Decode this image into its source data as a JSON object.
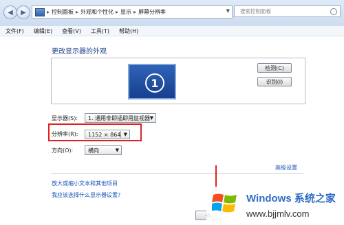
{
  "address_bar": {
    "breadcrumbs": [
      "控制面板",
      "外观和个性化",
      "显示",
      "屏幕分辨率"
    ],
    "search_placeholder": "搜索控制面板"
  },
  "menu": [
    "文件(F)",
    "编辑(E)",
    "查看(V)",
    "工具(T)",
    "帮助(H)"
  ],
  "main": {
    "title": "更改显示器的外观",
    "monitor_number": "1",
    "detect_label": "检测(C)",
    "identify_label": "识别(I)",
    "display_label": "显示器(S):",
    "display_value": "1. 通用非即插即用监视器",
    "resolution_label": "分辨率(R):",
    "resolution_value": "1152 × 864",
    "orientation_label": "方向(O):",
    "orientation_value": "横向",
    "advanced_link": "高级设置",
    "link_text_size": "放大或缩小文本和其他项目",
    "link_which_settings": "我应该选择什么显示器设置?",
    "ok_label": "确"
  },
  "watermark": {
    "brand": "Windows",
    "brand_cn": "系统之家",
    "url": "www.bjjmlv.com"
  },
  "colors": {
    "highlight": "#e02020",
    "link": "#1a55b8",
    "title": "#1e3f86"
  }
}
